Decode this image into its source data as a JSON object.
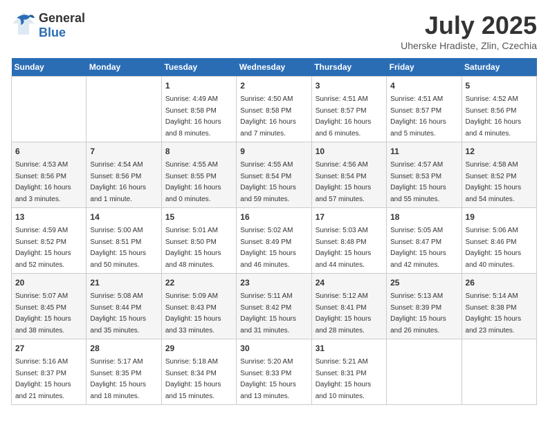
{
  "header": {
    "logo_general": "General",
    "logo_blue": "Blue",
    "title": "July 2025",
    "location": "Uherske Hradiste, Zlin, Czechia"
  },
  "days_of_week": [
    "Sunday",
    "Monday",
    "Tuesday",
    "Wednesday",
    "Thursday",
    "Friday",
    "Saturday"
  ],
  "weeks": [
    [
      {
        "day": "",
        "info": ""
      },
      {
        "day": "",
        "info": ""
      },
      {
        "day": "1",
        "info": "Sunrise: 4:49 AM\nSunset: 8:58 PM\nDaylight: 16 hours and 8 minutes."
      },
      {
        "day": "2",
        "info": "Sunrise: 4:50 AM\nSunset: 8:58 PM\nDaylight: 16 hours and 7 minutes."
      },
      {
        "day": "3",
        "info": "Sunrise: 4:51 AM\nSunset: 8:57 PM\nDaylight: 16 hours and 6 minutes."
      },
      {
        "day": "4",
        "info": "Sunrise: 4:51 AM\nSunset: 8:57 PM\nDaylight: 16 hours and 5 minutes."
      },
      {
        "day": "5",
        "info": "Sunrise: 4:52 AM\nSunset: 8:56 PM\nDaylight: 16 hours and 4 minutes."
      }
    ],
    [
      {
        "day": "6",
        "info": "Sunrise: 4:53 AM\nSunset: 8:56 PM\nDaylight: 16 hours and 3 minutes."
      },
      {
        "day": "7",
        "info": "Sunrise: 4:54 AM\nSunset: 8:56 PM\nDaylight: 16 hours and 1 minute."
      },
      {
        "day": "8",
        "info": "Sunrise: 4:55 AM\nSunset: 8:55 PM\nDaylight: 16 hours and 0 minutes."
      },
      {
        "day": "9",
        "info": "Sunrise: 4:55 AM\nSunset: 8:54 PM\nDaylight: 15 hours and 59 minutes."
      },
      {
        "day": "10",
        "info": "Sunrise: 4:56 AM\nSunset: 8:54 PM\nDaylight: 15 hours and 57 minutes."
      },
      {
        "day": "11",
        "info": "Sunrise: 4:57 AM\nSunset: 8:53 PM\nDaylight: 15 hours and 55 minutes."
      },
      {
        "day": "12",
        "info": "Sunrise: 4:58 AM\nSunset: 8:52 PM\nDaylight: 15 hours and 54 minutes."
      }
    ],
    [
      {
        "day": "13",
        "info": "Sunrise: 4:59 AM\nSunset: 8:52 PM\nDaylight: 15 hours and 52 minutes."
      },
      {
        "day": "14",
        "info": "Sunrise: 5:00 AM\nSunset: 8:51 PM\nDaylight: 15 hours and 50 minutes."
      },
      {
        "day": "15",
        "info": "Sunrise: 5:01 AM\nSunset: 8:50 PM\nDaylight: 15 hours and 48 minutes."
      },
      {
        "day": "16",
        "info": "Sunrise: 5:02 AM\nSunset: 8:49 PM\nDaylight: 15 hours and 46 minutes."
      },
      {
        "day": "17",
        "info": "Sunrise: 5:03 AM\nSunset: 8:48 PM\nDaylight: 15 hours and 44 minutes."
      },
      {
        "day": "18",
        "info": "Sunrise: 5:05 AM\nSunset: 8:47 PM\nDaylight: 15 hours and 42 minutes."
      },
      {
        "day": "19",
        "info": "Sunrise: 5:06 AM\nSunset: 8:46 PM\nDaylight: 15 hours and 40 minutes."
      }
    ],
    [
      {
        "day": "20",
        "info": "Sunrise: 5:07 AM\nSunset: 8:45 PM\nDaylight: 15 hours and 38 minutes."
      },
      {
        "day": "21",
        "info": "Sunrise: 5:08 AM\nSunset: 8:44 PM\nDaylight: 15 hours and 35 minutes."
      },
      {
        "day": "22",
        "info": "Sunrise: 5:09 AM\nSunset: 8:43 PM\nDaylight: 15 hours and 33 minutes."
      },
      {
        "day": "23",
        "info": "Sunrise: 5:11 AM\nSunset: 8:42 PM\nDaylight: 15 hours and 31 minutes."
      },
      {
        "day": "24",
        "info": "Sunrise: 5:12 AM\nSunset: 8:41 PM\nDaylight: 15 hours and 28 minutes."
      },
      {
        "day": "25",
        "info": "Sunrise: 5:13 AM\nSunset: 8:39 PM\nDaylight: 15 hours and 26 minutes."
      },
      {
        "day": "26",
        "info": "Sunrise: 5:14 AM\nSunset: 8:38 PM\nDaylight: 15 hours and 23 minutes."
      }
    ],
    [
      {
        "day": "27",
        "info": "Sunrise: 5:16 AM\nSunset: 8:37 PM\nDaylight: 15 hours and 21 minutes."
      },
      {
        "day": "28",
        "info": "Sunrise: 5:17 AM\nSunset: 8:35 PM\nDaylight: 15 hours and 18 minutes."
      },
      {
        "day": "29",
        "info": "Sunrise: 5:18 AM\nSunset: 8:34 PM\nDaylight: 15 hours and 15 minutes."
      },
      {
        "day": "30",
        "info": "Sunrise: 5:20 AM\nSunset: 8:33 PM\nDaylight: 15 hours and 13 minutes."
      },
      {
        "day": "31",
        "info": "Sunrise: 5:21 AM\nSunset: 8:31 PM\nDaylight: 15 hours and 10 minutes."
      },
      {
        "day": "",
        "info": ""
      },
      {
        "day": "",
        "info": ""
      }
    ]
  ]
}
